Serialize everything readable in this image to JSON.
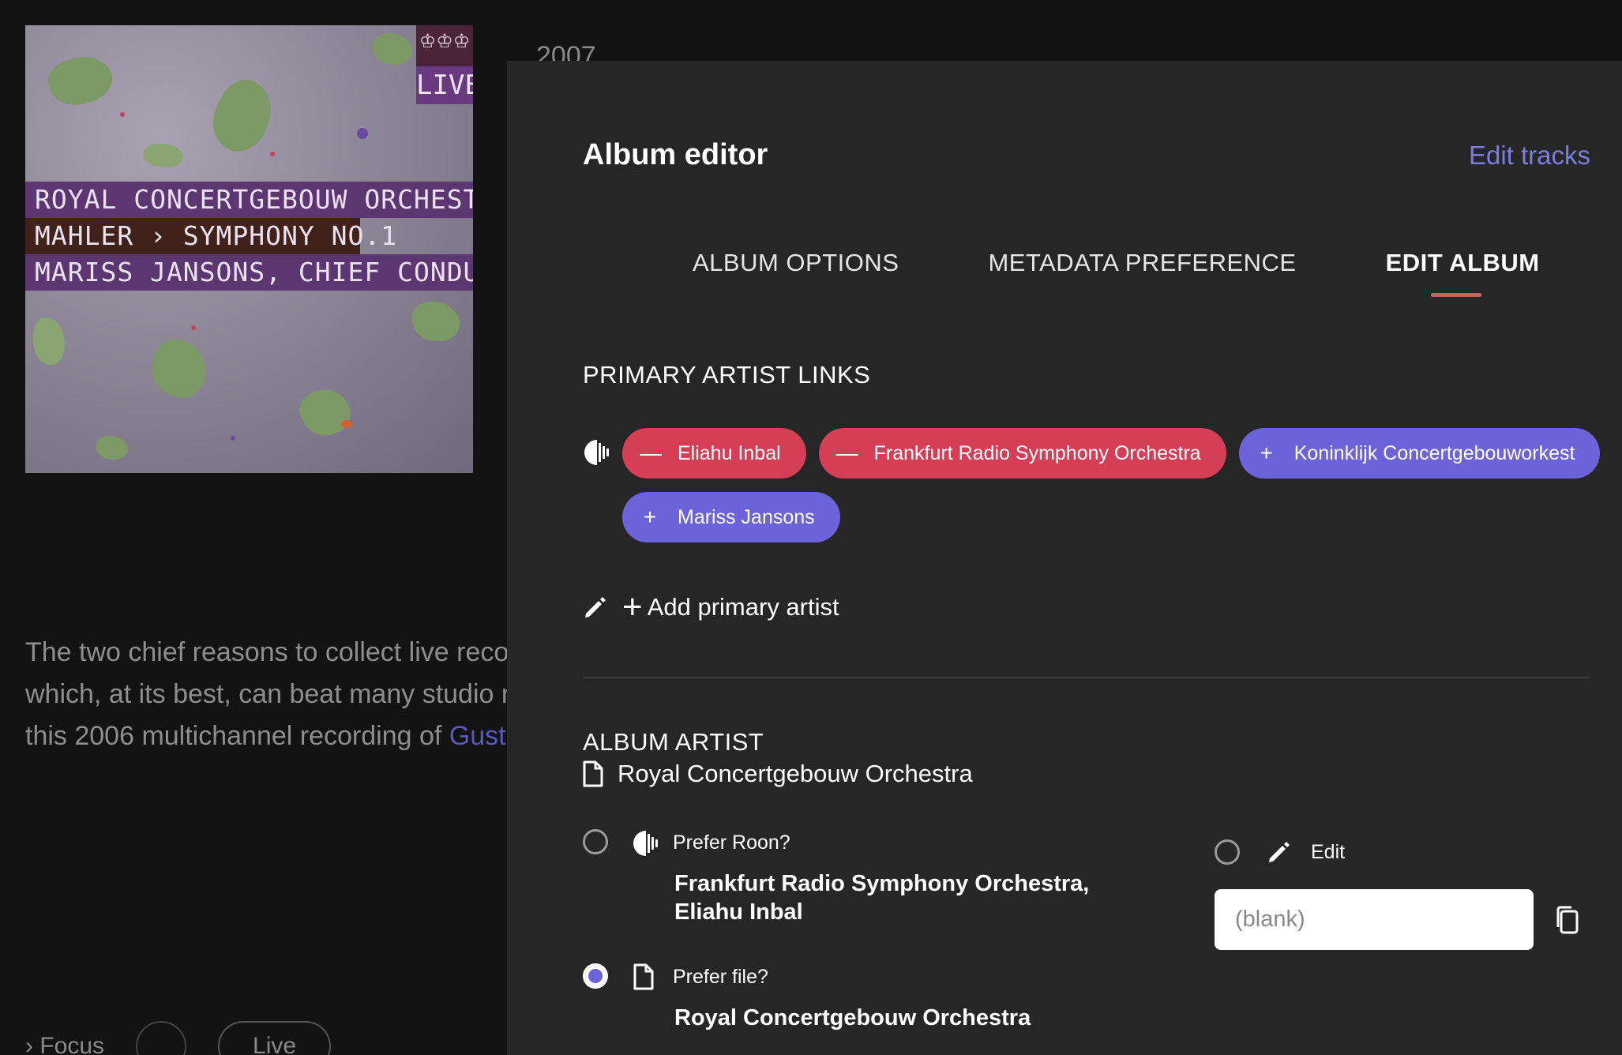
{
  "background": {
    "year": "2007",
    "cover": {
      "live_badge": "LIVE",
      "line1": "ROYAL CONCERTGEBOUW ORCHESTRA",
      "line2": "MAHLER › SYMPHONY NO.1",
      "line3": "MARISS JANSONS, CHIEF CONDUCTOR"
    },
    "review_lines": [
      "The two chief reasons to collect live reco",
      "which, at its best, can beat many studio re",
      "this 2006 multichannel recording of "
    ],
    "review_link": "Gust",
    "focus_label": "Focus",
    "live_pill": "Live"
  },
  "editor": {
    "title": "Album editor",
    "edit_tracks": "Edit tracks",
    "tabs": [
      "ALBUM OPTIONS",
      "METADATA PREFERENCE",
      "EDIT ALBUM"
    ],
    "active_tab": "EDIT ALBUM",
    "primary_artist_links": {
      "title": "PRIMARY ARTIST LINKS",
      "linked": [
        "Eliahu Inbal",
        "Frankfurt Radio Symphony Orchestra"
      ],
      "suggested": [
        "Koninklijk Concertgebouworkest",
        "Mariss Jansons"
      ],
      "add_label": "Add primary artist"
    },
    "album_artist": {
      "title": "ALBUM ARTIST",
      "file_value": "Royal Concertgebouw Orchestra",
      "prefer_roon_label": "Prefer Roon?",
      "prefer_roon_value": "Frankfurt Radio Symphony Orchestra, Eliahu Inbal",
      "prefer_file_label": "Prefer file?",
      "prefer_file_value": "Royal Concertgebouw Orchestra",
      "edit_label": "Edit",
      "edit_placeholder": "(blank)",
      "selected": "Prefer file?"
    }
  },
  "colors": {
    "panel_bg": "#262626",
    "page_bg": "#131313",
    "remove_chip": "#d43f55",
    "add_chip": "#6c63d8",
    "accent_link": "#7d7ce4",
    "tab_underline": "#c7615a"
  }
}
